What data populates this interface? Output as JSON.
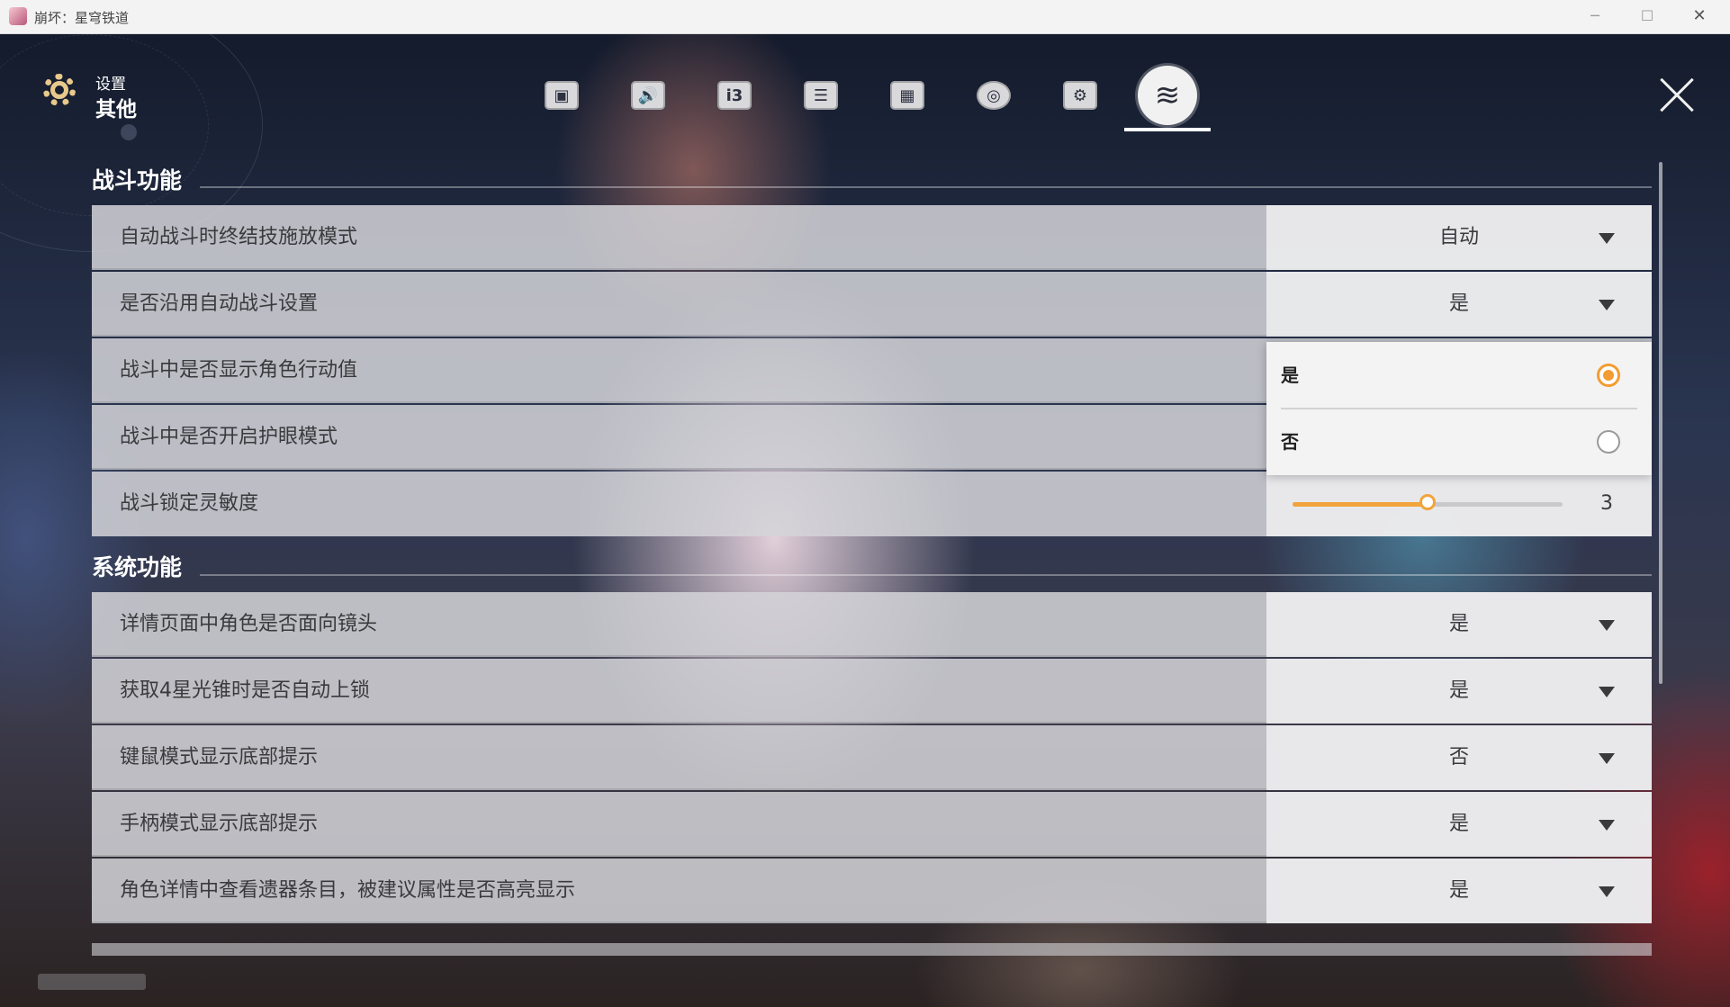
{
  "window": {
    "title": "崩坏：星穹铁道",
    "controls": {
      "minimize": "─",
      "maximize": "☐",
      "close": "✕"
    }
  },
  "header": {
    "section": "设置",
    "subsection": "其他"
  },
  "tabs": [
    {
      "name": "graphics",
      "glyph": "▣"
    },
    {
      "name": "audio",
      "glyph": "🔊"
    },
    {
      "name": "language",
      "glyph": "i3"
    },
    {
      "name": "account",
      "glyph": "☰"
    },
    {
      "name": "layout",
      "glyph": "▦"
    },
    {
      "name": "controller",
      "glyph": "◎"
    },
    {
      "name": "keybinds",
      "glyph": "⚙"
    },
    {
      "name": "other",
      "glyph": "≋",
      "active": true
    }
  ],
  "combat": {
    "title": "战斗功能",
    "rows": [
      {
        "label": "自动战斗时终结技施放模式",
        "value": "自动"
      },
      {
        "label": "是否沿用自动战斗设置",
        "value": "是"
      },
      {
        "label": "战斗中是否显示角色行动值"
      },
      {
        "label": "战斗中是否开启护眼模式"
      },
      {
        "label": "战斗锁定灵敏度",
        "slider_value": "3",
        "slider_fraction": 0.5
      }
    ],
    "dropdown_options": [
      {
        "label": "是",
        "selected": true
      },
      {
        "label": "否",
        "selected": false
      }
    ]
  },
  "system": {
    "title": "系统功能",
    "rows": [
      {
        "label": "详情页面中角色是否面向镜头",
        "value": "是"
      },
      {
        "label": "获取4星光锥时是否自动上锁",
        "value": "是"
      },
      {
        "label": "键鼠模式显示底部提示",
        "value": "否"
      },
      {
        "label": "手柄模式显示底部提示",
        "value": "是"
      },
      {
        "label": "角色详情中查看遗器条目，被建议属性是否高亮显示",
        "value": "是"
      }
    ]
  },
  "colors": {
    "accent": "#f39c32",
    "gear": "#e9c98b"
  }
}
